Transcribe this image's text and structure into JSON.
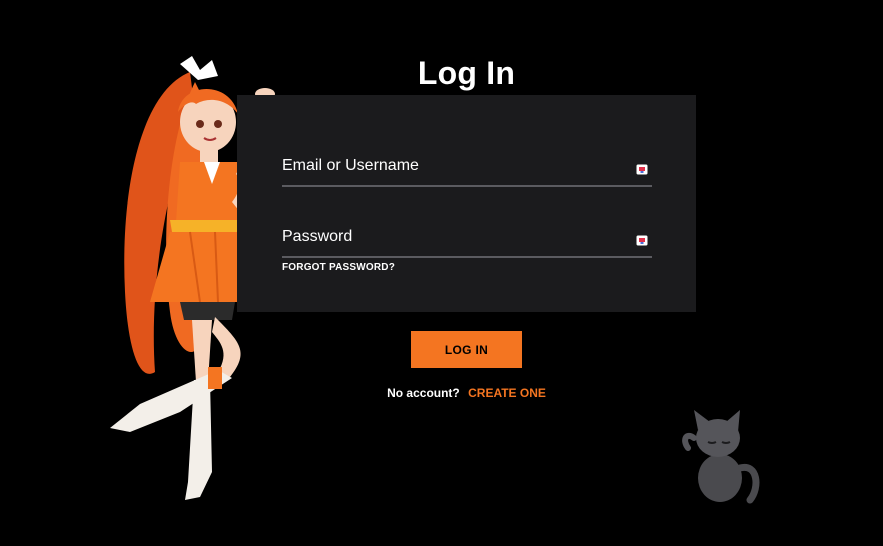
{
  "header": {
    "title": "Log In"
  },
  "form": {
    "email_label": "Email or Username",
    "password_label": "Password",
    "forgot_password": "FORGOT PASSWORD?",
    "field_icon": "password-manager-icon"
  },
  "actions": {
    "login_label": "LOG IN"
  },
  "signup": {
    "question": "No account?",
    "link": "CREATE ONE"
  },
  "decor": {
    "left": "anime-mascot-illustration",
    "right": "cat-illustration"
  },
  "colors": {
    "background": "#000000",
    "card": "#1b1b1d",
    "accent": "#f47521",
    "underline": "#5b5b60",
    "text": "#ffffff"
  }
}
